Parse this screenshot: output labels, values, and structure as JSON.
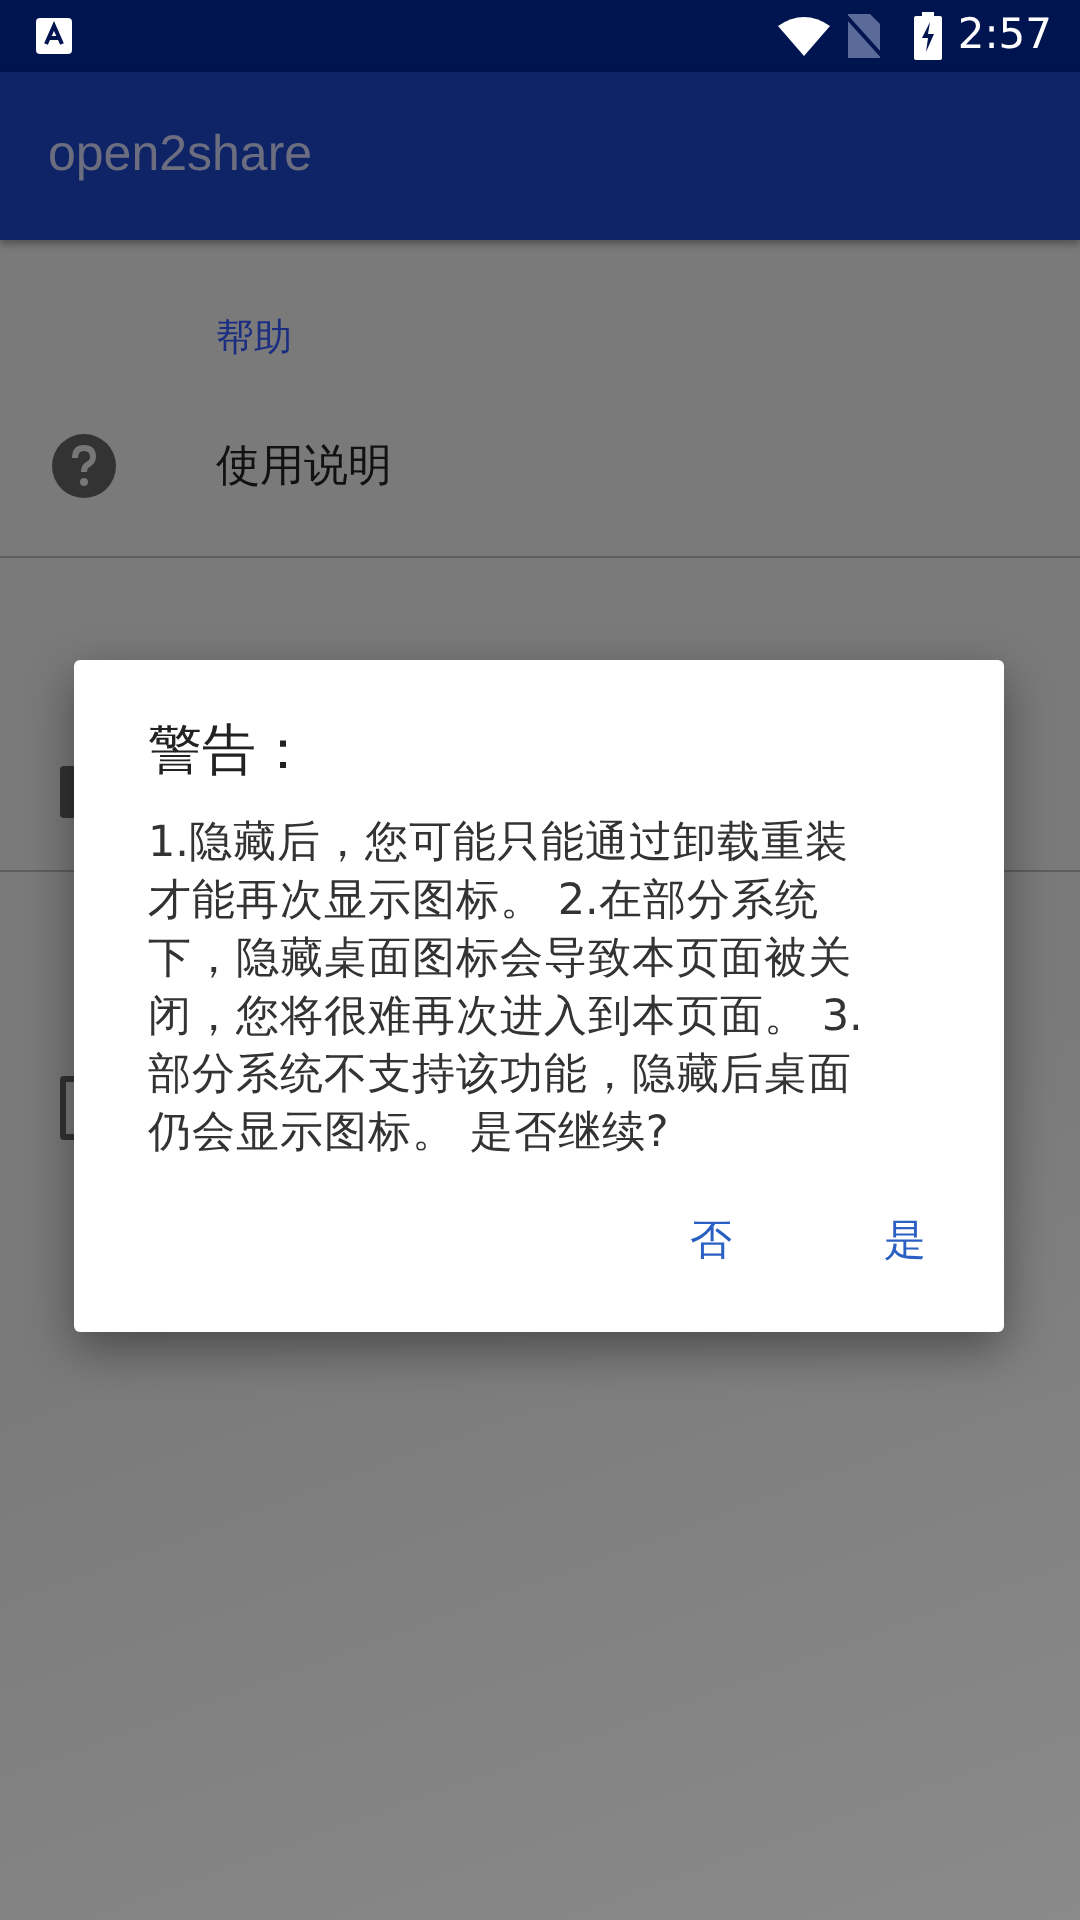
{
  "status_bar": {
    "time": "2:57"
  },
  "app_bar": {
    "title": "open2share"
  },
  "sections": [
    {
      "header": "帮助",
      "items": [
        {
          "label": "使用说明"
        }
      ]
    }
  ],
  "dialog": {
    "title": "警告：",
    "message": "1.隐藏后，您可能只能通过卸载重装才能再次显示图标。 2.在部分系统下，隐藏桌面图标会导致本页面被关闭，您将很难再次进入到本页面。 3.部分系统不支持该功能，隐藏后桌面仍会显示图标。 是否继续?",
    "buttons": [
      "否",
      "是"
    ]
  }
}
